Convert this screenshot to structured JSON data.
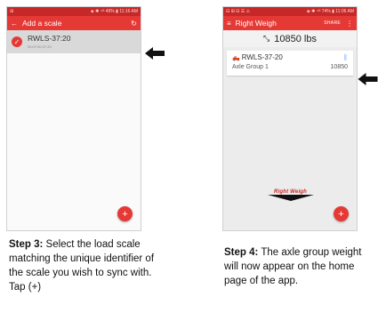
{
  "step3": {
    "status_left": "⊞",
    "status_right": "◈ ✱ ⁴ᴳ 49% ▮ 11:16 AM",
    "back_icon": "arrow-left-icon",
    "title": "Add a scale",
    "refresh_icon": "refresh-icon",
    "scale": {
      "name": "RWLS-37:20",
      "sub": "00:07:00:37:20"
    },
    "fab": "+",
    "caption_bold": "Step 3:",
    "caption_text": " Select the load scale matching the unique identifier of the scale you wish to sync with.  Tap (+)"
  },
  "step4": {
    "status_left": "⊟ ⊞ ⊟ ☰ ⚠",
    "status_right": "◈ ✱ ⁴ᴳ 74% ▮ 11:06 AM",
    "menu_icon": "hamburger-icon",
    "title": "Right Weigh",
    "share": "SHARE",
    "more_icon": "more-vert-icon",
    "total": "10850 lbs",
    "axle": {
      "name": "RWLS-37-20",
      "group": "Axle Group 1",
      "weight": "10850"
    },
    "logo": "Right Weigh",
    "fab": "+",
    "caption_bold": "Step 4:",
    "caption_text": "  The axle group weight will now appear on the home page of the app."
  },
  "colors": {
    "accent": "#e53935",
    "status": "#c62828",
    "bluetooth": "#2979ff"
  }
}
